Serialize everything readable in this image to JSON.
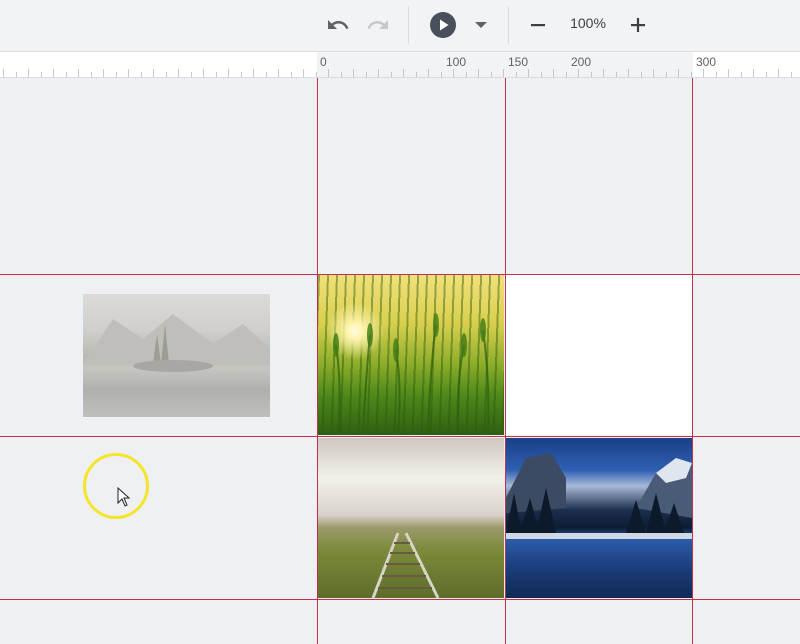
{
  "toolbar": {
    "undo_icon": "undo-icon",
    "redo_icon": "redo-icon",
    "play_icon": "play-icon",
    "play_menu_icon": "caret-down-icon",
    "zoom_out_icon": "minus-icon",
    "zoom_level": "100%",
    "zoom_in_icon": "plus-icon"
  },
  "ruler": {
    "labels": [
      "0",
      "100",
      "150",
      "200",
      "300"
    ]
  },
  "canvas": {
    "guide_color": "#c2304a",
    "cells": [
      {
        "name": "wheat-field-image",
        "content": "image"
      },
      {
        "name": "empty-white-cell",
        "content": "blank"
      },
      {
        "name": "railway-track-image",
        "content": "image"
      },
      {
        "name": "mountain-lake-image",
        "content": "image"
      }
    ],
    "dragged_item": "faded-lake-image",
    "cursor_highlight_color": "#f5e52a"
  }
}
